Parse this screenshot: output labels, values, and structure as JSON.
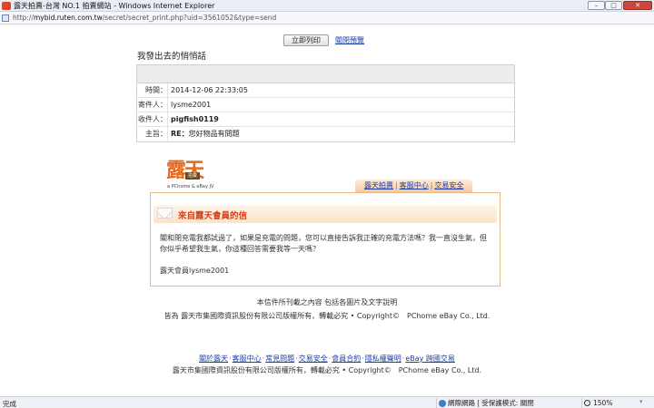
{
  "window": {
    "title": "露天拍賣-台灣 NO.1 拍賣網站 - Windows Internet Explorer",
    "min_label": "–",
    "max_label": "□",
    "close_label": "✕"
  },
  "address": {
    "scheme": "http://",
    "host": "mybid.ruten.com.tw",
    "path": "/secret/secret_print.php?uid=3561052&type=send"
  },
  "toolbar": {
    "print_label": "立即列印",
    "close_preview_label": "關閉預覽"
  },
  "page_title": "我發出去的悄悄話",
  "message": {
    "rows": [
      {
        "label": "時間：",
        "value": "2014-12-06 22:33:05"
      },
      {
        "label": "寄件人：",
        "value": "lysme2001"
      },
      {
        "label": "收件人：",
        "value": "pigfish0119"
      }
    ],
    "subject_label": "主旨：",
    "subject_prefix": "RE：",
    "subject_text": "您好物品有問題"
  },
  "logo": {
    "chars": "露天",
    "tag": "拍賣",
    "sub": "a PChome & eBay JV"
  },
  "nav": {
    "links": [
      "露天拍賣",
      "客服中心",
      "交易安全"
    ],
    "separator": "|"
  },
  "card": {
    "heading": "來自露天會員的信",
    "body": "關和閉充電我都試過了，如果是充電的問題，您可以直接告訴我正確的充電方法嗎？我一直沒生氣，但你似乎希望我生氣，你這種回答需要我等一天嗎？",
    "signature": "露天會員lysme2001"
  },
  "footer": {
    "notice": "本信件所刊載之內容 包括各圖片及文字說明",
    "copyright": "皆為 露天市集國際資訊股份有限公司版權所有，轉載必究 • Copyright©　PChome eBay Co., Ltd.",
    "links": [
      "關於露天",
      "客服中心",
      "常見問題",
      "交易安全",
      "會員合約",
      "隱私權聲明",
      "eBay 跨國交易"
    ],
    "link_separator": "‧",
    "bottom_copy": "露天市集國際資訊股份有限公司版權所有，轉載必究 • Copyright©　PChome eBay Co., Ltd."
  },
  "status": {
    "text": "完成",
    "zone": "網際網路 | 受保護模式: 關閉",
    "zoom": "150%",
    "grip": "▾"
  },
  "colors": {
    "accent_orange": "#e2691f",
    "heading_red": "#d2431b",
    "link_blue": "#1a3fa8",
    "card_border": "#e9b98a"
  }
}
